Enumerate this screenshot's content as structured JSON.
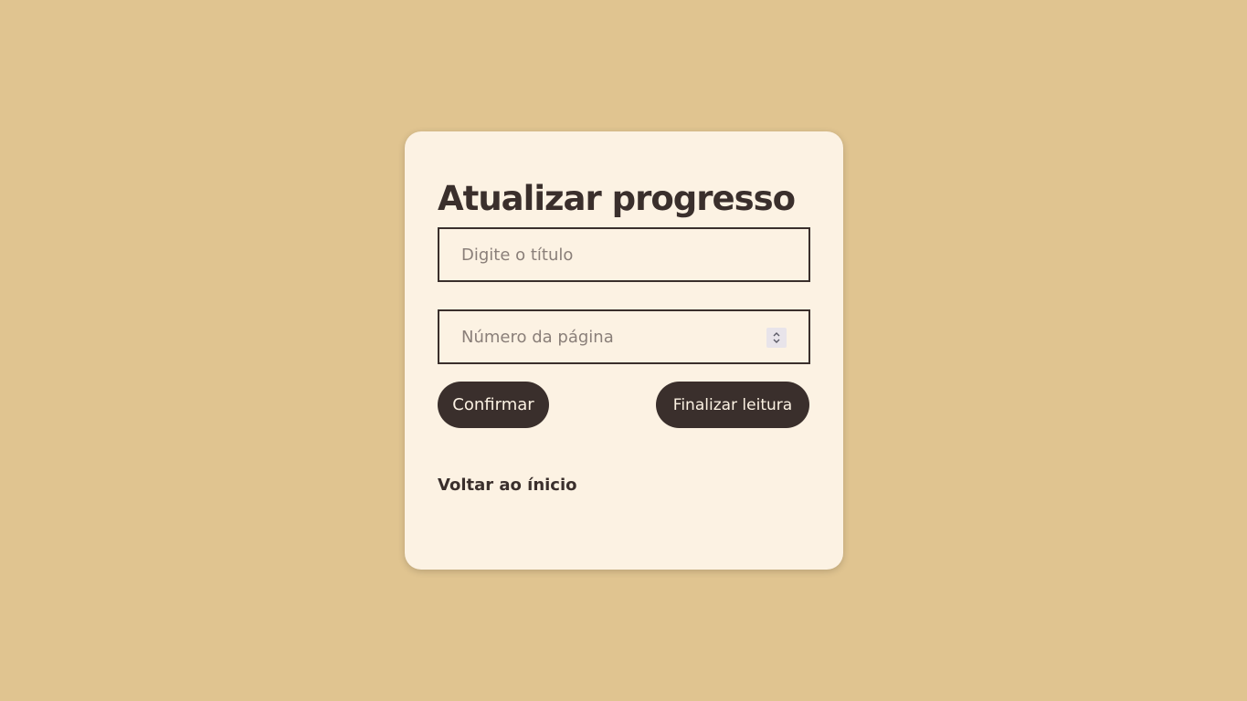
{
  "form": {
    "title": "Atualizar progresso",
    "title_input": {
      "placeholder": "Digite o título",
      "value": ""
    },
    "page_input": {
      "placeholder": "Número da página",
      "value": ""
    },
    "confirm_label": "Confirmar",
    "finish_label": "Finalizar leitura",
    "back_label": "Voltar ao ínicio"
  },
  "colors": {
    "background": "#e0c490",
    "card": "#fcf2e3",
    "primary": "#3a2f2c",
    "placeholder": "#8a7f79"
  },
  "icons": {
    "spinner": "number-spinner-icon"
  }
}
